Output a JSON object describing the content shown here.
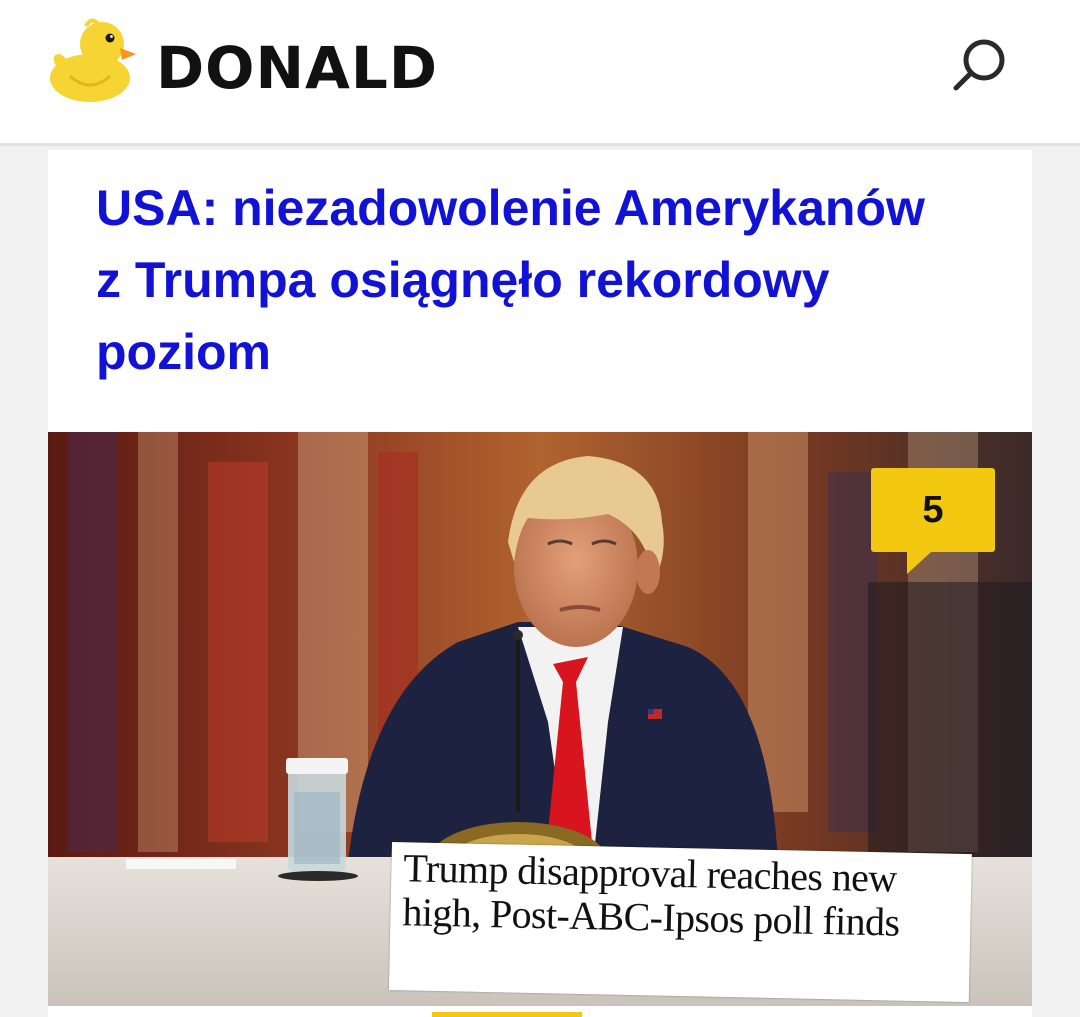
{
  "header": {
    "brand": "DONALD",
    "logo_icon": "rubber-duck-icon",
    "search_icon": "search-icon"
  },
  "article": {
    "title": "USA: niezadowolenie Amerykanów z Trumpa osiągnęło rekordowy poziom",
    "comment_count": "5",
    "comment_icon": "speech-bubble-icon",
    "image_caption_text": "Trump disapproval reaches new high, Post-ABC-Ipsos poll finds"
  },
  "colors": {
    "headline": "#1212d6",
    "badge": "#f2c811",
    "brand_text": "#111111",
    "duck": "#f5d433",
    "duck_beak": "#f29a1f"
  }
}
